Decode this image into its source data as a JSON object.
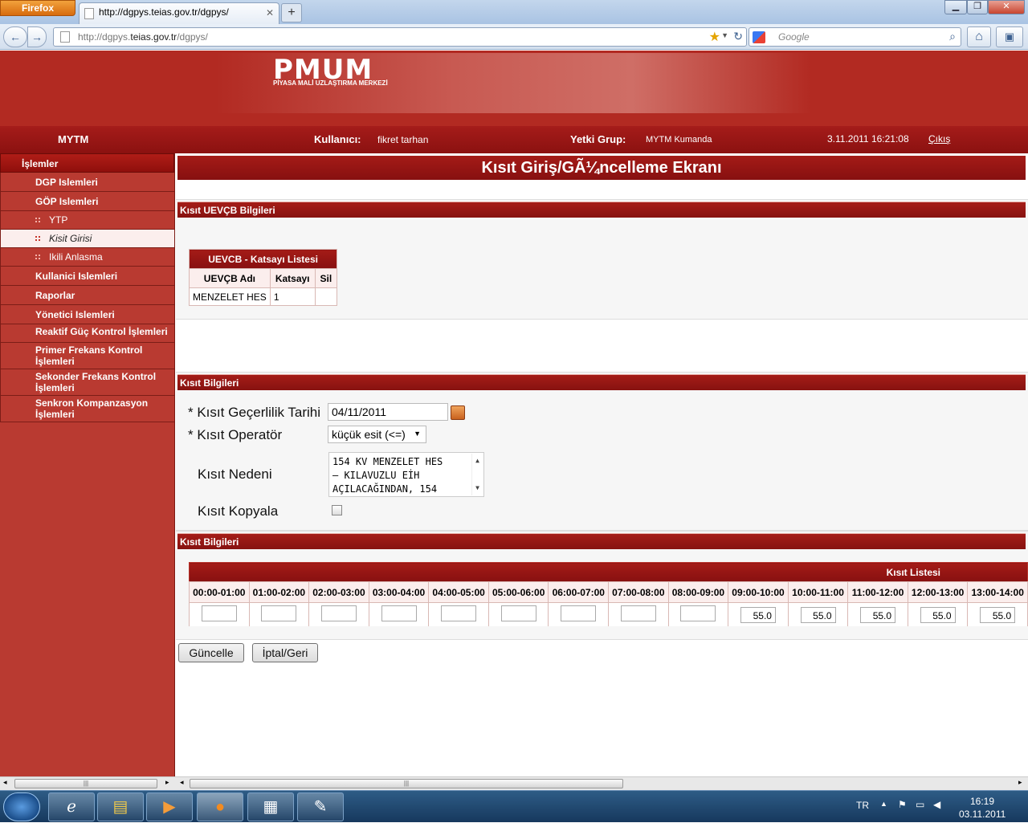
{
  "browser": {
    "menu_label": "Firefox",
    "tab_title": "http://dgpys.teias.gov.tr/dgpys/",
    "url_prefix": "http://dgpys.",
    "url_domain": "teias.gov.tr",
    "url_path": "/dgpys/",
    "search_placeholder": "Google",
    "new_tab_label": "+"
  },
  "header": {
    "logo_text": "PMUM",
    "logo_subtitle": "PİYASA MALİ UZLAŞTIRMA MERKEZİ",
    "org": "MYTM",
    "user_label": "Kullanıcı:",
    "user_name": "fikret tarhan",
    "group_label": "Yetki Grup:",
    "group_name": "MYTM Kumanda",
    "datetime": "3.11.2011 16:21:08",
    "logout_label": "Çıkış"
  },
  "sidebar": {
    "title": "İşlemler",
    "items": [
      {
        "label": "DGP Islemleri"
      },
      {
        "label": "GÖP Islemleri"
      },
      {
        "label": "YTP"
      },
      {
        "label": "Kisit Girisi"
      },
      {
        "label": "Ikili Anlasma"
      },
      {
        "label": "Kullanici Islemleri"
      },
      {
        "label": "Raporlar"
      },
      {
        "label": "Yönetici Islemleri"
      },
      {
        "label": "Reaktif Güç Kontrol İşlemleri"
      },
      {
        "label": "Primer Frekans Kontrol İşlemleri"
      },
      {
        "label": "Sekonder Frekans Kontrol İşlemleri"
      },
      {
        "label": "Senkron Kompanzasyon İşlemleri"
      }
    ]
  },
  "main": {
    "page_title": "Kısıt Giriş/GÃ¼ncelleme Ekranı",
    "section1_title": "Kısıt UEVÇB Bilgileri",
    "katsayi": {
      "caption": "UEVCB - Katsayı Listesi",
      "headers": [
        "UEVÇB Adı",
        "Katsayı",
        "Sil"
      ],
      "rows": [
        [
          "MENZELET HES",
          "1",
          ""
        ]
      ]
    },
    "section2_title": "Kısıt Bilgileri",
    "form": {
      "date_label": "* Kısıt Geçerlilik Tarihi",
      "date_value": "04/11/2011",
      "operator_label": "* Kısıt Operatör",
      "operator_value": "küçük esit (<=)",
      "reason_label": "Kısıt Nedeni",
      "reason_value": "154 KV MENZELET HES\n– KILAVUZLU EİH\nAÇILACAĞINDAN, 154",
      "copy_label": "Kısıt Kopyala"
    },
    "section3_title": "Kısıt Bilgileri",
    "hours": {
      "caption": "Kısıt Listesi",
      "headers": [
        "00:00-01:00",
        "01:00-02:00",
        "02:00-03:00",
        "03:00-04:00",
        "04:00-05:00",
        "05:00-06:00",
        "06:00-07:00",
        "07:00-08:00",
        "08:00-09:00",
        "09:00-10:00",
        "10:00-11:00",
        "11:00-12:00",
        "12:00-13:00",
        "13:00-14:00"
      ],
      "values": [
        "",
        "",
        "",
        "",
        "",
        "",
        "",
        "",
        "",
        "55.0",
        "55.0",
        "55.0",
        "55.0",
        "55.0"
      ]
    },
    "update_button": "Güncelle",
    "cancel_button": "İptal/Geri"
  },
  "taskbar": {
    "lang": "TR",
    "time": "16:19",
    "date": "03.11.2011"
  }
}
